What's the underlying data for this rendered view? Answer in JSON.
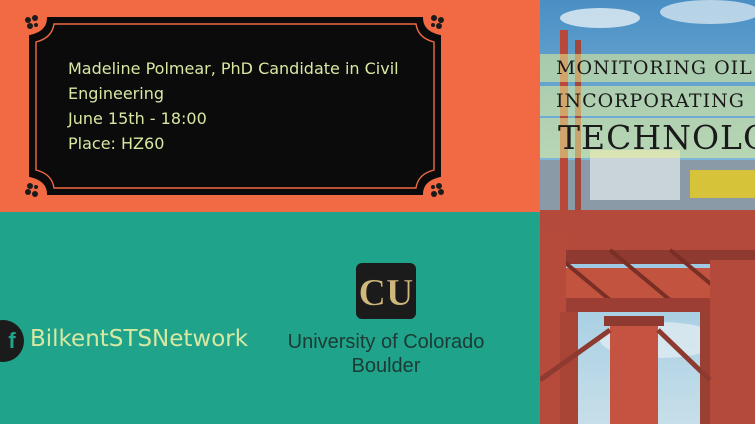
{
  "event": {
    "speaker_line1": "Madeline Polmear, PhD Candidate in Civil",
    "speaker_line2": "Engineering",
    "date": "June 15th - 18:00",
    "place": "Place: HZ60"
  },
  "social": {
    "icon": "facebook-icon",
    "glyph": "f",
    "handle": "BilkentSTSNetwork"
  },
  "university": {
    "logo_text": "CU",
    "name_line1": "University of Colorado",
    "name_line2": "Boulder"
  },
  "title": {
    "line1": "MONITORING OIL",
    "line2": "INCORPORATING",
    "line3": "TECHNOLOGY"
  },
  "colors": {
    "orange": "#f26a43",
    "teal": "#1fa38a",
    "plaque": "#0c0b0b",
    "text_light": "#d7e8a3",
    "gold": "#cfb87c"
  }
}
